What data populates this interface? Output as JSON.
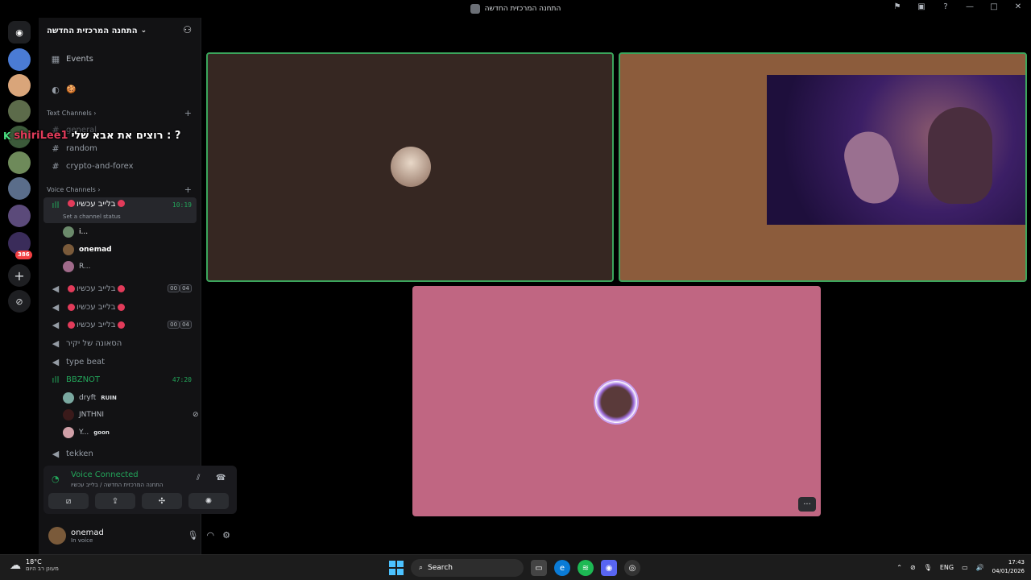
{
  "window": {
    "title": "התחנה המרכזית החדשה"
  },
  "server_rail": {
    "badge": "386"
  },
  "guild": {
    "name": "התחנה המרכזית החדשה"
  },
  "sidebar": {
    "events": "Events",
    "cookie": "🍪",
    "text_category": "Text Channels",
    "text_channels": [
      "general",
      "random",
      "crypto-and-forex"
    ],
    "voice_category": "Voice Channels",
    "voice_channels": [
      {
        "name": "בלייב עכשיו",
        "timer": "10:19",
        "status": "Set a channel status"
      },
      {
        "name": "בלייב עכשיו",
        "count_a": "00",
        "count_b": "04"
      },
      {
        "name": "בלייב עכשיו"
      },
      {
        "name": "בלייב עכשיו",
        "count_a": "00",
        "count_b": "04"
      },
      {
        "name": "הסאונה של יקיר"
      },
      {
        "name": "type beat"
      },
      {
        "name": "BBZNOT",
        "timer": "47:20"
      },
      {
        "name": "tekken"
      }
    ],
    "users_ch1": [
      "i...",
      "onemad",
      "R..."
    ],
    "users_bbz": [
      {
        "name": "dryft",
        "tag": "RUIN"
      },
      {
        "name": "JNTHNI"
      },
      {
        "name": "Y...",
        "tag": "goon"
      }
    ]
  },
  "overlay": {
    "user": "shiriLee1",
    "message": "רוצים את אבא שלי : ?"
  },
  "voice_panel": {
    "title": "Voice Connected",
    "subtitle": "התחנה המרכזית החדשה / בלייב עכשיו"
  },
  "userbar": {
    "name": "onemad",
    "status": "In voice"
  },
  "taskbar": {
    "temp": "18°C",
    "weather": "מעונן רב היום",
    "search": "Search",
    "lang": "ENG",
    "time": "17:43",
    "date": "04/01/2026"
  },
  "colors": {
    "speaking": "#3ba55c",
    "tile1": "#362722",
    "tile2": "#8c5c3c",
    "tile3": "#c06682"
  }
}
